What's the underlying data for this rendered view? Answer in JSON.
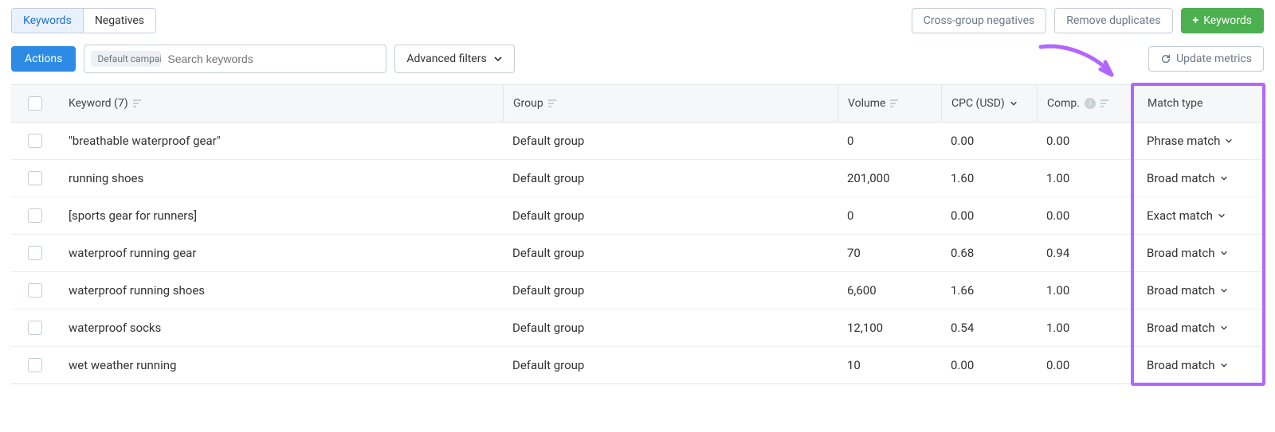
{
  "tabs": {
    "keywords": "Keywords",
    "negatives": "Negatives"
  },
  "top_buttons": {
    "cross_group": "Cross-group negatives",
    "remove_dups": "Remove duplicates",
    "add_keywords": "Keywords"
  },
  "toolbar": {
    "actions": "Actions",
    "search_chip": "Default campaign",
    "search_placeholder": "Search keywords",
    "advanced": "Advanced filters",
    "update": "Update metrics"
  },
  "headers": {
    "keyword": "Keyword (7)",
    "group": "Group",
    "volume": "Volume",
    "cpc": "CPC (USD)",
    "comp": "Comp.",
    "match": "Match type"
  },
  "rows": [
    {
      "keyword": "\"breathable waterproof gear\"",
      "group": "Default group",
      "volume": "0",
      "cpc": "0.00",
      "comp": "0.00",
      "match": "Phrase match"
    },
    {
      "keyword": "running shoes",
      "group": "Default group",
      "volume": "201,000",
      "cpc": "1.60",
      "comp": "1.00",
      "match": "Broad match"
    },
    {
      "keyword": "[sports gear for runners]",
      "group": "Default group",
      "volume": "0",
      "cpc": "0.00",
      "comp": "0.00",
      "match": "Exact match"
    },
    {
      "keyword": "waterproof running gear",
      "group": "Default group",
      "volume": "70",
      "cpc": "0.68",
      "comp": "0.94",
      "match": "Broad match"
    },
    {
      "keyword": "waterproof running shoes",
      "group": "Default group",
      "volume": "6,600",
      "cpc": "1.66",
      "comp": "1.00",
      "match": "Broad match"
    },
    {
      "keyword": "waterproof socks",
      "group": "Default group",
      "volume": "12,100",
      "cpc": "0.54",
      "comp": "1.00",
      "match": "Broad match"
    },
    {
      "keyword": "wet weather running",
      "group": "Default group",
      "volume": "10",
      "cpc": "0.00",
      "comp": "0.00",
      "match": "Broad match"
    }
  ],
  "annotation": {
    "highlight_column": "match"
  }
}
